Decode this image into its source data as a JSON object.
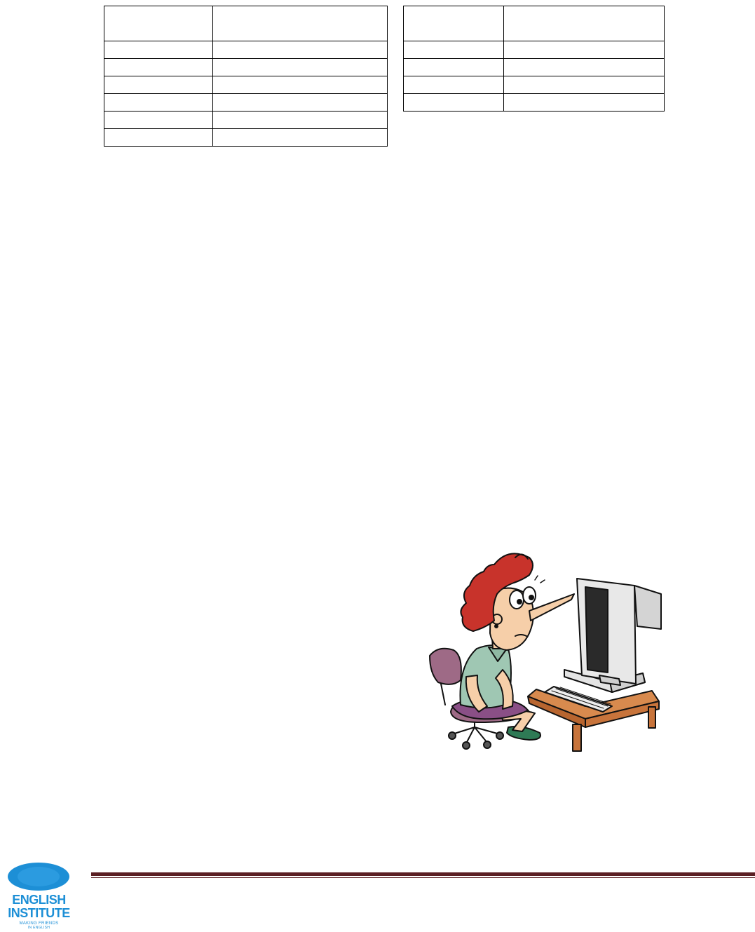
{
  "tables": {
    "left": {
      "header": [
        "",
        ""
      ],
      "rows": [
        [
          "",
          ""
        ],
        [
          "",
          ""
        ],
        [
          "",
          ""
        ],
        [
          "",
          ""
        ],
        [
          "",
          ""
        ],
        [
          "",
          ""
        ]
      ]
    },
    "right": {
      "header": [
        "",
        ""
      ],
      "rows": [
        [
          "",
          ""
        ],
        [
          "",
          ""
        ],
        [
          "",
          ""
        ],
        [
          "",
          ""
        ]
      ]
    }
  },
  "illustration": {
    "icon": "woman-at-computer-cartoon-icon",
    "colors": {
      "hair": "#c8332b",
      "skin": "#f6cfa9",
      "shirt": "#9fc7b3",
      "skirt": "#8a4f86",
      "chair": "#9e6a86",
      "desk": "#c8743b",
      "monitor": "#e6e6e6",
      "shoes": "#2e7a55"
    }
  },
  "footer": {
    "rule_color": "#5b1f23",
    "logo": {
      "icon": "english-institute-logo",
      "line1": "ENGLISH",
      "line2": "INSTITUTE",
      "tagline1": "MAKING FRIENDS",
      "tagline2": "IN ENGLISH",
      "color": "#1d8fd6"
    }
  }
}
